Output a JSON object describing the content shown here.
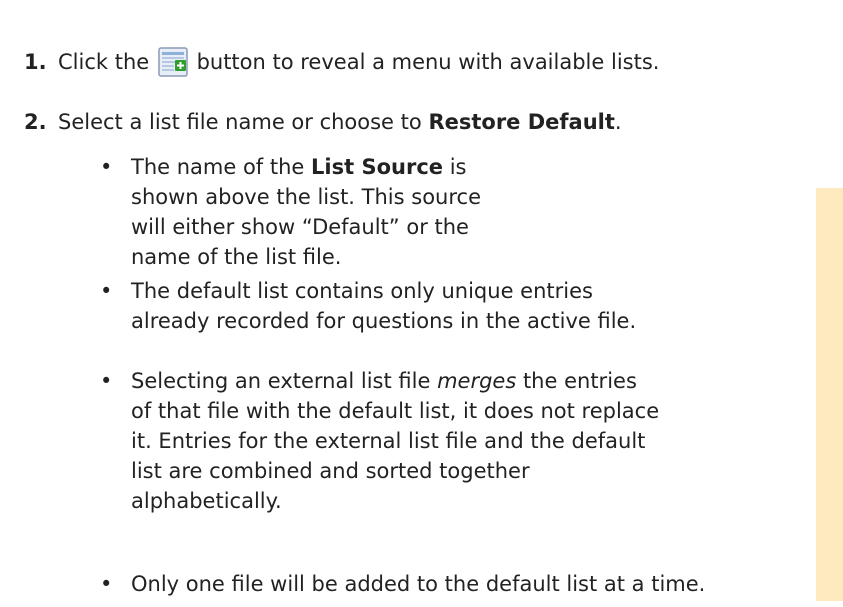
{
  "steps": [
    {
      "number": "1.",
      "text_before": "Click the",
      "button_icon": "add-list-icon",
      "text_after": "button to reveal a menu with available lists."
    },
    {
      "number": "2.",
      "text_before": "Select a list file name or choose to",
      "bold": "Restore Default",
      "text_after": "."
    }
  ],
  "bullets": [
    {
      "text_before": "The name of the",
      "bold": "List Source",
      "text_after": "is shown above the list. This source will either show “Default” or the name of the list file."
    },
    {
      "text": "The default list contains only unique entries already recorded for questions in the active file."
    },
    {
      "text_before": "Selecting an external list file",
      "italic": "merges",
      "text_after": "the entries of that file with the default list, it does not replace it. Entries for the external list file and the default list are combined and sorted together alphabetically."
    },
    {
      "text": "Only one file will be added to the default list at a time."
    }
  ],
  "bullet_symbol": "•",
  "colors": {
    "text": "#222222",
    "sidebar_band": "#fdebbf",
    "icon_green": "#2e9e2e"
  }
}
